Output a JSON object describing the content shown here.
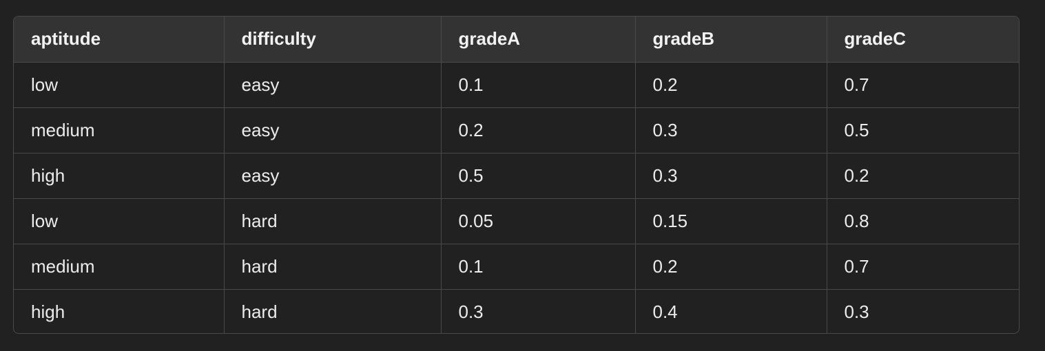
{
  "table": {
    "columns": [
      "aptitude",
      "difficulty",
      "gradeA",
      "gradeB",
      "gradeC"
    ],
    "rows": [
      [
        "low",
        "easy",
        "0.1",
        "0.2",
        "0.7"
      ],
      [
        "medium",
        "easy",
        "0.2",
        "0.3",
        "0.5"
      ],
      [
        "high",
        "easy",
        "0.5",
        "0.3",
        "0.2"
      ],
      [
        "low",
        "hard",
        "0.05",
        "0.15",
        "0.8"
      ],
      [
        "medium",
        "hard",
        "0.1",
        "0.2",
        "0.7"
      ],
      [
        "high",
        "hard",
        "0.3",
        "0.4",
        "0.3"
      ]
    ]
  },
  "colors": {
    "background": "#212121",
    "header_background": "#333333",
    "border": "#4a4a4a",
    "text": "#ececec"
  }
}
